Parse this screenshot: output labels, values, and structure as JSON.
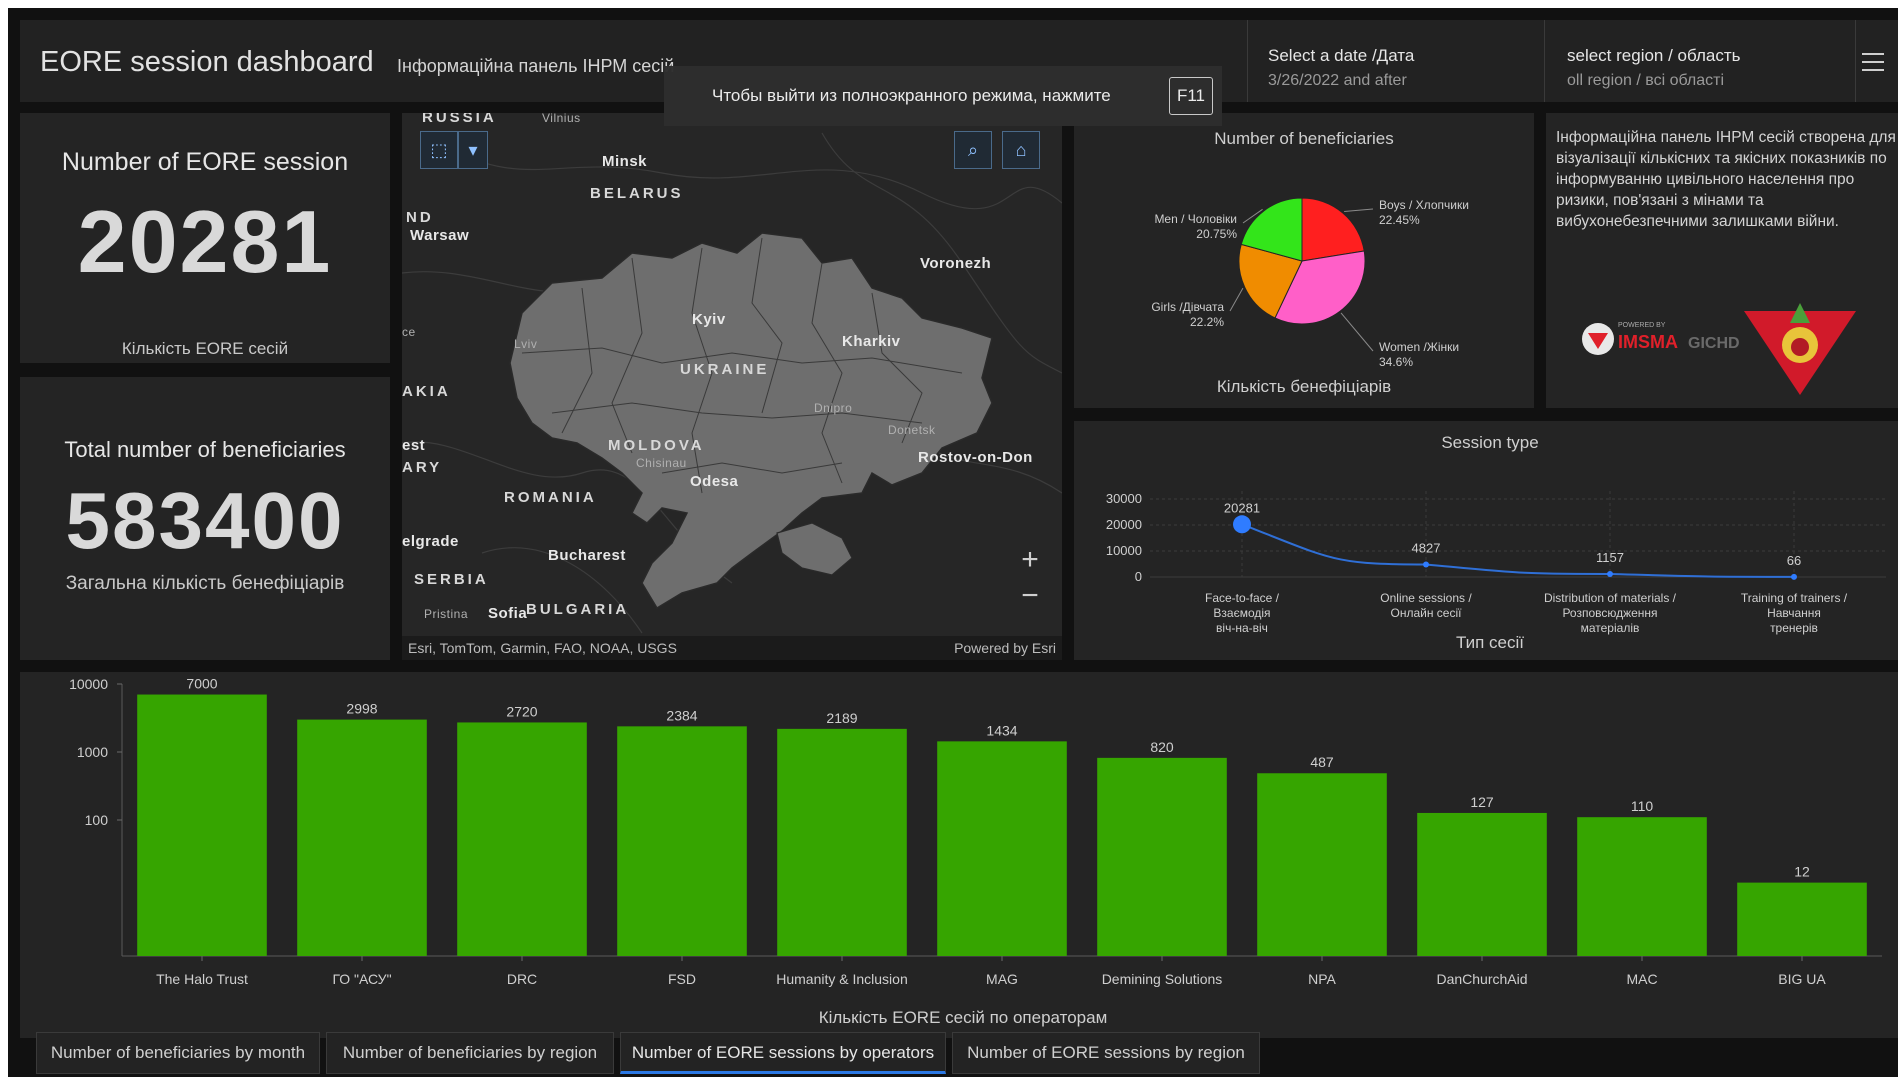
{
  "header": {
    "title": "EORE session dashboard",
    "subtitle": "Інформаційна панель ІНРМ сесій",
    "date_selector": {
      "label": "Select a date /Дата",
      "value": "3/26/2022 and after"
    },
    "region_selector": {
      "label": "select region / область",
      "value": "oll region / всі області"
    },
    "menu_icon": "hamburger-menu-icon"
  },
  "fullscreen_notice": {
    "message": "Чтобы выйти из полноэкранного режима, нажмите",
    "key": "F11"
  },
  "indicators": {
    "sessions": {
      "title": "Number of EORE session",
      "value": "20281",
      "subtitle": "Кількість EORE сесій"
    },
    "beneficiaries": {
      "title": "Total number of beneficiaries",
      "value": "583400",
      "subtitle": "Загальна кількість бенефіціарів"
    }
  },
  "map": {
    "labels": {
      "russia": "RUSSIA",
      "vilnius": "Vilnius",
      "minsk": "Minsk",
      "belarus": "BELARUS",
      "nd": "ND",
      "warsaw": "Warsaw",
      "voronezh": "Voronezh",
      "kyiv": "Kyiv",
      "lviv": "Lviv",
      "kharkiv": "Kharkiv",
      "ukraine": "UKRAINE",
      "dnipro": "Dnipro",
      "donetsk": "Donetsk",
      "akia": "AKIA",
      "ce": "ce",
      "moldova": "MOLDOVA",
      "chisinau": "Chisinau",
      "est": "est",
      "ary": "ARY",
      "odesa": "Odesa",
      "rostov": "Rostov-on-Don",
      "romania": "ROMANIA",
      "belgrade": "elgrade",
      "bucharest": "Bucharest",
      "serbia": "SERBIA",
      "pristina": "Pristina",
      "sofia": "Sofia",
      "bulgaria": "BULGARIA"
    },
    "attribution": "Esri, TomTom, Garmin, FAO, NOAA, USGS",
    "powered_by": "Powered by Esri",
    "tools": {
      "select": "select-area-icon",
      "dropdown": "chevron-down-icon",
      "search": "search-icon",
      "home": "home-icon"
    },
    "zoom_in": "+",
    "zoom_out": "−"
  },
  "info": {
    "text": "Інформаційна панель ІНРМ сесій створена для візуалізації кількісних та якісних показників по інформуванню цивільного населення про ризики, пов'язані з мінами та вибухонебезпечними залишками війни.",
    "logo_imsma": "IMSMA",
    "logo_gichd": "GICHD",
    "logo_powered": "POWERED BY"
  },
  "tabs": [
    "Number of beneficiaries by month",
    "Number of beneficiaries by region",
    "Number of EORE sessions by operators",
    "Number of EORE sessions by region"
  ],
  "colors": {
    "accent": "#2b78e4",
    "bar": "#36a500",
    "line": "#2f6fd6",
    "panel": "#242424",
    "background": "#111111"
  },
  "chart_data": [
    {
      "type": "pie",
      "title": "Number of beneficiaries",
      "subtitle": "Кількість бенефіціарів",
      "slices": [
        {
          "label": "Boys / Хлопчики",
          "value": 22.45,
          "display": "22.45%",
          "color": "#ff1f1f"
        },
        {
          "label": "Women /Жінки",
          "value": 34.6,
          "display": "34.6%",
          "color": "#ff5fc8"
        },
        {
          "label": "Girls /Дівчата",
          "value": 22.2,
          "display": "22.2%",
          "color": "#f08c00"
        },
        {
          "label": "Men / Чоловіки",
          "value": 20.75,
          "display": "20.75%",
          "color": "#33e51a"
        }
      ]
    },
    {
      "type": "line",
      "title": "Session type",
      "subtitle": "Тип сесії",
      "categories": [
        "Face-to-face / Взаємодія віч-на-віч",
        "Online sessions / Онлайн сесії",
        "Distribution of materials / Розповсюдження матеріалів",
        "Training of trainers / Навчання тренерів"
      ],
      "values": [
        20281,
        4827,
        1157,
        66
      ],
      "yticks": [
        0,
        10000,
        20000,
        30000
      ],
      "ylim": [
        0,
        30000
      ]
    },
    {
      "type": "bar",
      "title": "",
      "subtitle": "Кількість EORE сесій по операторам",
      "scale": "log",
      "categories": [
        "The Halo Trust",
        "ГО \"АСУ\"",
        "DRC",
        "FSD",
        "Humanity & Inclusion",
        "MAG",
        "Demining Solutions",
        "NPA",
        "DanChurchAid",
        "MAC",
        "BIG UA"
      ],
      "values": [
        7000,
        2998,
        2720,
        2384,
        2189,
        1434,
        820,
        487,
        127,
        110,
        12
      ],
      "yticks": [
        100,
        1000,
        10000
      ]
    }
  ]
}
